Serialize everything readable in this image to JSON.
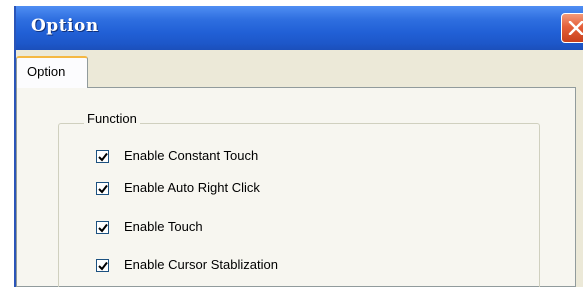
{
  "window": {
    "title": "Option"
  },
  "tabs": [
    {
      "label": "Option",
      "selected": true
    }
  ],
  "function_group": {
    "title": "Function",
    "options": [
      {
        "label": "Enable Constant Touch",
        "checked": true
      },
      {
        "label": "Enable Auto Right Click",
        "checked": true
      },
      {
        "label": "Enable Touch",
        "checked": true
      },
      {
        "label": "Enable Cursor Stablization",
        "checked": true
      }
    ]
  },
  "icons": {
    "close": "close-icon",
    "check": "checkmark-icon"
  },
  "colors": {
    "titlebar": "#2160d6",
    "close_button": "#e5603a",
    "dialog_background": "#ece9d8",
    "tab_highlight": "#f5b843"
  }
}
